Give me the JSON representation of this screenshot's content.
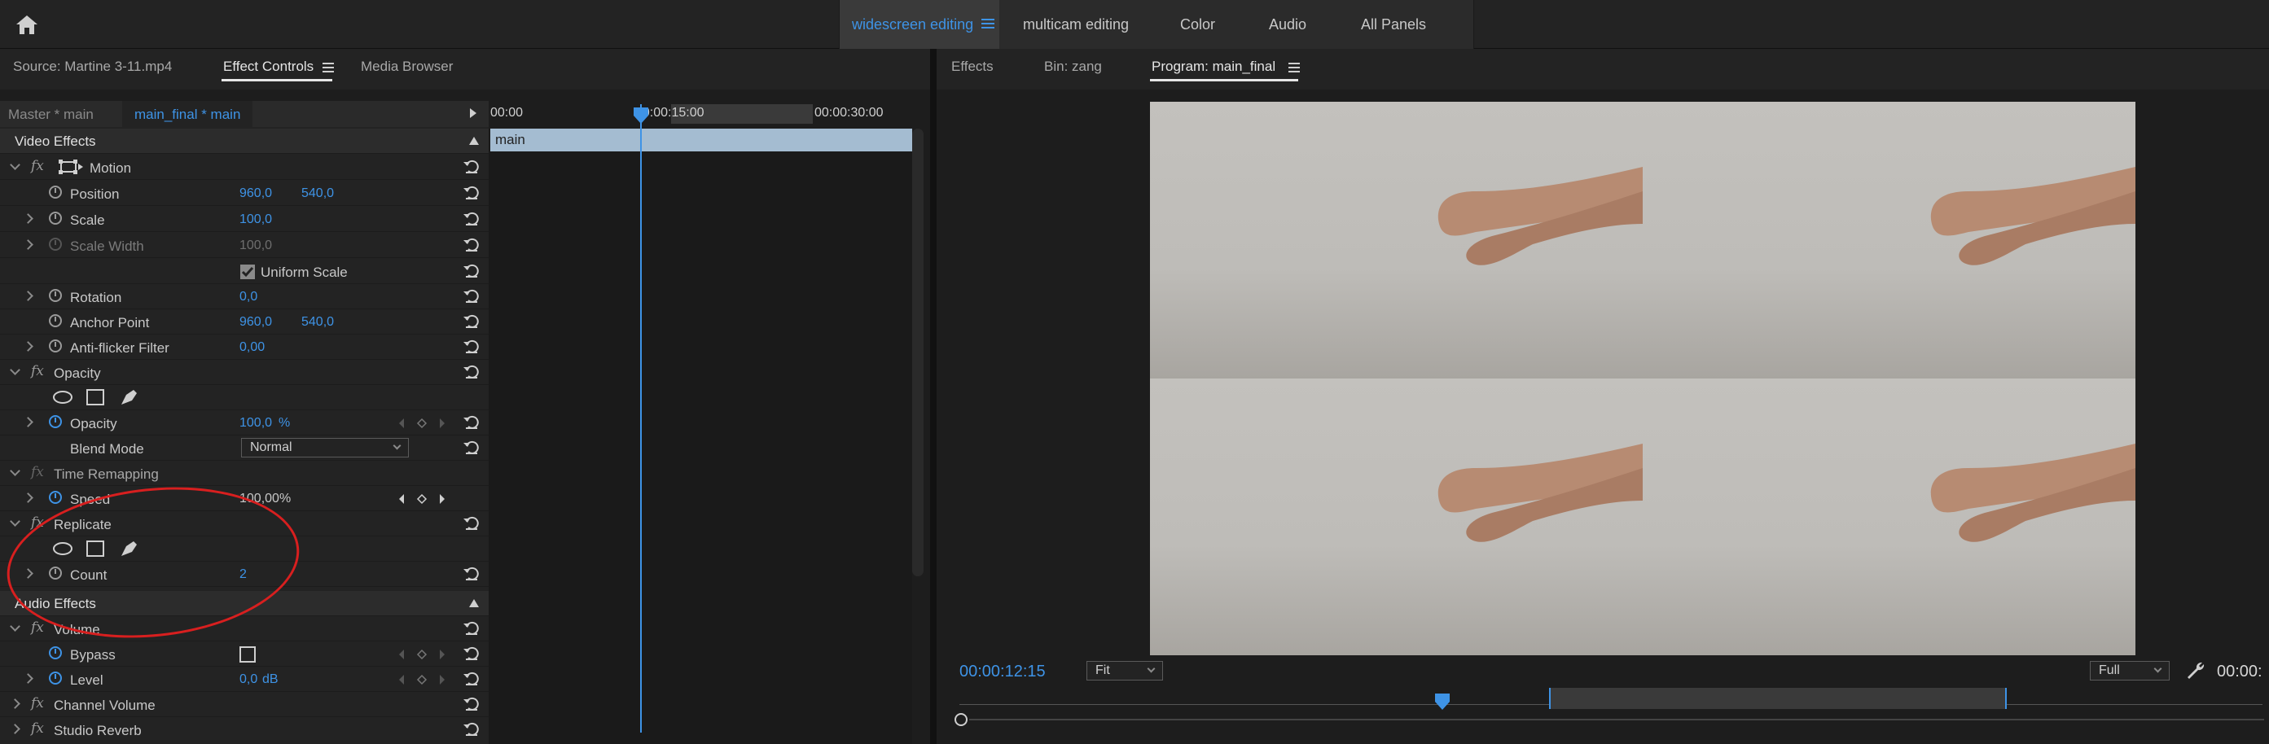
{
  "topbar": {
    "workspaces": [
      "widescreen editing",
      "multicam editing",
      "Color",
      "Audio",
      "All Panels"
    ],
    "active_workspace": "widescreen editing"
  },
  "left_panel": {
    "tabs": [
      "Source: Martine 3-11.mp4",
      "Effect Controls",
      "Media Browser"
    ],
    "active_tab": "Effect Controls",
    "sequence_tabs": [
      "Master * main",
      "main_final * main"
    ],
    "active_sequence": "main_final * main",
    "ruler": [
      "00:00",
      "00:00:15:00",
      "00:00:30:00"
    ],
    "clip_name": "main",
    "video_effects_title": "Video Effects",
    "motion": {
      "title": "Motion",
      "position_label": "Position",
      "position_x": "960,0",
      "position_y": "540,0",
      "scale_label": "Scale",
      "scale_value": "100,0",
      "scale_width_label": "Scale Width",
      "scale_width_value": "100,0",
      "uniform_scale_label": "Uniform Scale",
      "rotation_label": "Rotation",
      "rotation_value": "0,0",
      "anchor_label": "Anchor Point",
      "anchor_x": "960,0",
      "anchor_y": "540,0",
      "antiflicker_label": "Anti-flicker Filter",
      "antiflicker_value": "0,00"
    },
    "opacity": {
      "title": "Opacity",
      "opacity_label": "Opacity",
      "opacity_value": "100,0",
      "opacity_unit": "%",
      "blend_label": "Blend Mode",
      "blend_value": "Normal"
    },
    "time_remap": {
      "title": "Time Remapping",
      "speed_label": "Speed",
      "speed_value": "100,00%"
    },
    "replicate": {
      "title": "Replicate",
      "count_label": "Count",
      "count_value": "2"
    },
    "audio_effects_title": "Audio Effects",
    "volume": {
      "title": "Volume",
      "bypass_label": "Bypass",
      "level_label": "Level",
      "level_value": "0,0",
      "level_unit": "dB"
    },
    "channel_volume_title": "Channel Volume",
    "studio_reverb_title": "Studio Reverb"
  },
  "right_panel": {
    "tabs": [
      "Effects",
      "Bin: zang",
      "Program: main_final"
    ],
    "active_tab": "Program: main_final",
    "timecode": "00:00:12:15",
    "fit_label": "Fit",
    "resolution_label": "Full",
    "end_timecode": "00:00:"
  },
  "colors": {
    "accent": "#3e93e6",
    "annotation": "#d81f1f"
  }
}
